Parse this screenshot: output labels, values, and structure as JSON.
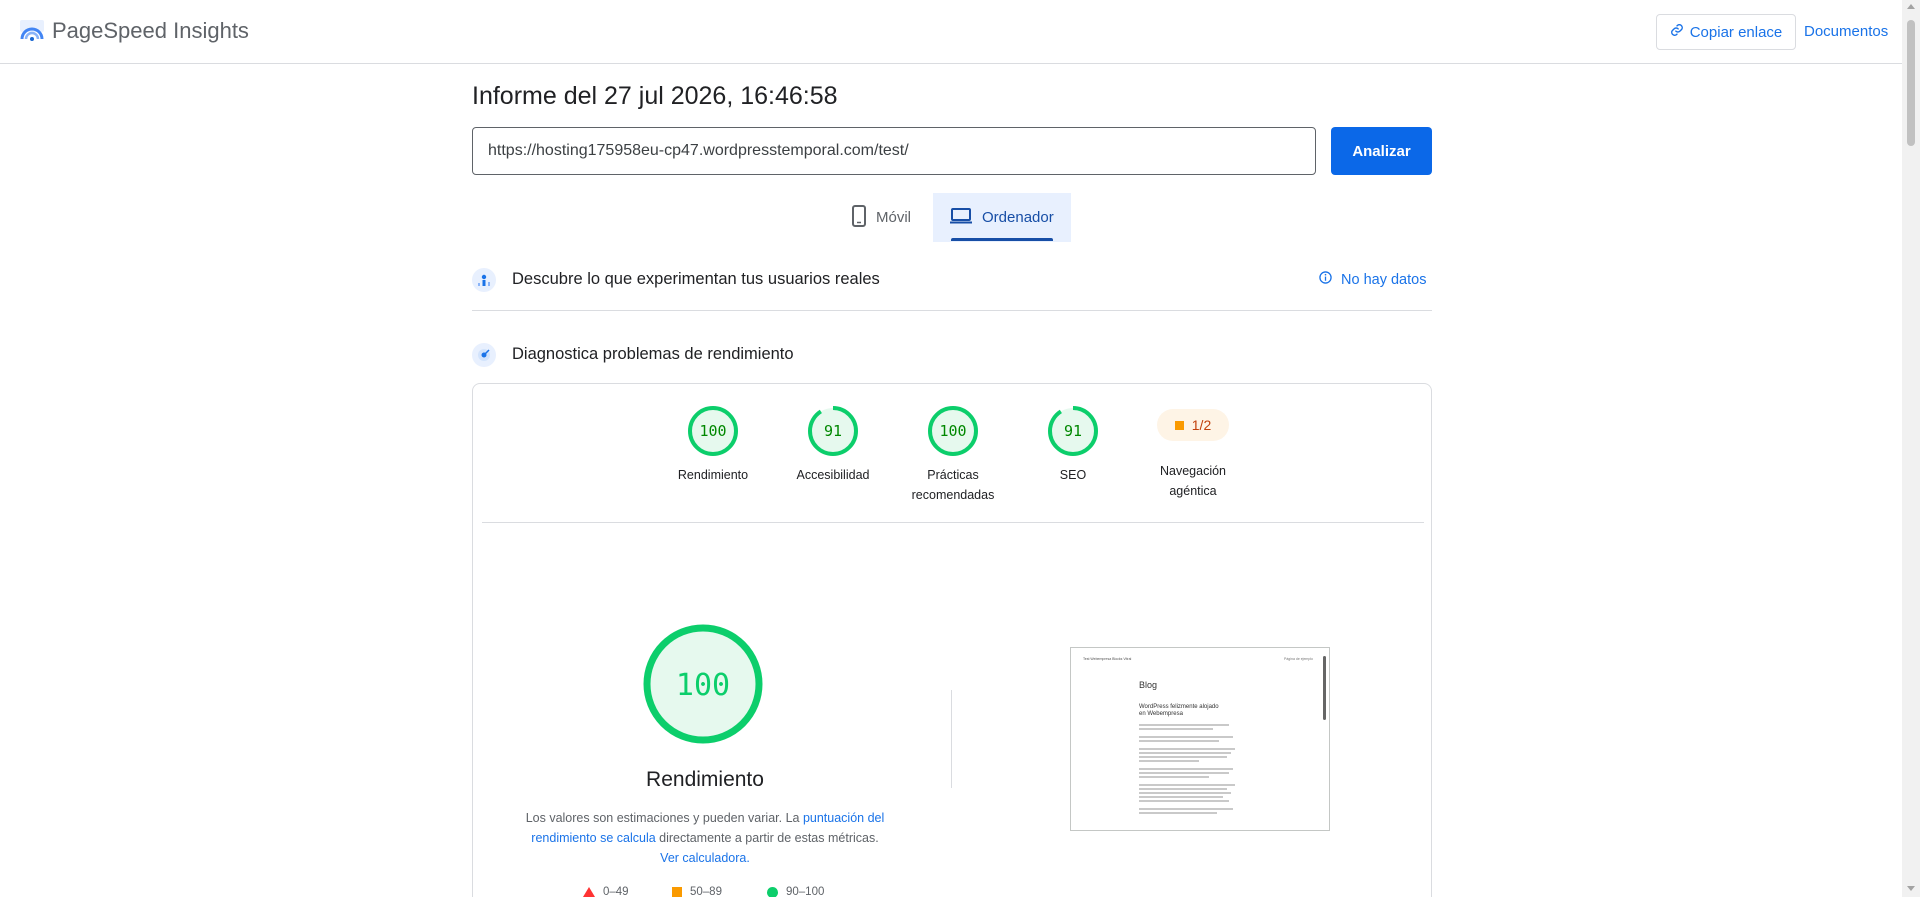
{
  "header": {
    "app_title": "PageSpeed Insights",
    "copy_link_label": "Copiar enlace",
    "docs_label": "Documentos"
  },
  "report": {
    "title": "Informe del 27 jul 2026, 16:46:58",
    "url_value": "https://hosting175958eu-cp47.wordpresstemporal.com/test/",
    "analyze_label": "Analizar"
  },
  "tabs": [
    {
      "label": "Móvil",
      "active": false,
      "icon": "phone-icon"
    },
    {
      "label": "Ordenador",
      "active": true,
      "icon": "laptop-icon"
    }
  ],
  "crux": {
    "title": "Descubre lo que experimentan tus usuarios reales",
    "no_data_label": "No hay datos"
  },
  "diagnostics": {
    "title": "Diagnostica problemas de rendimiento",
    "scores": [
      {
        "value": "100",
        "label": "Rendimiento",
        "fraction": 1.0
      },
      {
        "value": "91",
        "label": "Accesibilidad",
        "fraction": 0.91
      },
      {
        "value": "100",
        "label": "Prácticas recomendadas",
        "fraction": 1.0
      },
      {
        "value": "91",
        "label": "SEO",
        "fraction": 0.91
      }
    ],
    "agentic": {
      "value": "1/2",
      "label": "Navegación agéntica"
    }
  },
  "performance": {
    "score": "100",
    "score_fraction": 1.0,
    "label": "Rendimiento",
    "desc_text_1": "Los valores son estimaciones y pueden variar. La ",
    "desc_link_1": "puntuación del rendimiento se calcula",
    "desc_text_2": " directamente a partir de estas métricas. ",
    "desc_link_2": "Ver calculadora.",
    "legend": [
      "0–49",
      "50–89",
      "90–100"
    ]
  },
  "thumbnail": {
    "site_header": "Test Webempresa Blocks Vitral",
    "site_header_right": "Página de ejemplo",
    "blog_title": "Blog",
    "post_title": "WordPress felizmente alojado en Webempresa"
  },
  "colors": {
    "good": "#0cce6b",
    "good_text": "#008800",
    "average": "#fa9a00",
    "fail": "#ff3333",
    "link": "#1a73e8"
  }
}
